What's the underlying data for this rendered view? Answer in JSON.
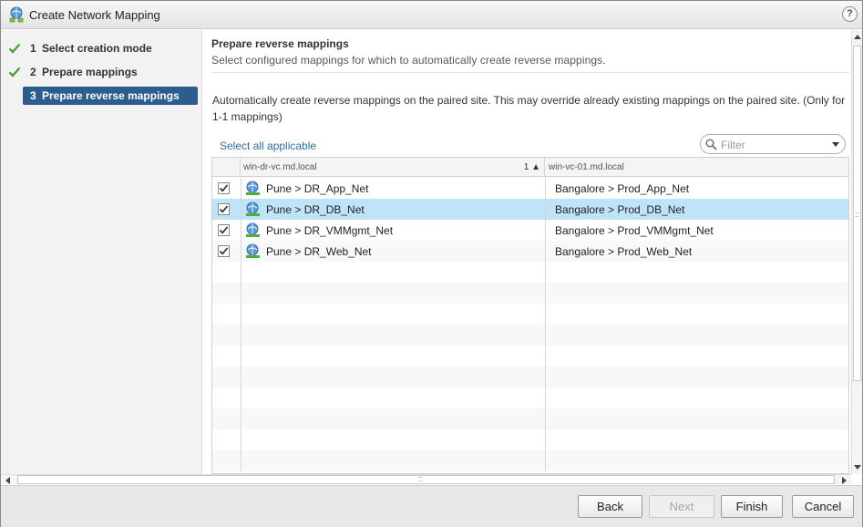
{
  "window": {
    "title": "Create Network Mapping",
    "help_label": "?"
  },
  "steps": [
    {
      "num": "1",
      "label": "Select creation mode",
      "state": "done"
    },
    {
      "num": "2",
      "label": "Prepare mappings",
      "state": "done"
    },
    {
      "num": "3",
      "label": "Prepare reverse mappings",
      "state": "active"
    }
  ],
  "section": {
    "title": "Prepare reverse mappings",
    "subtitle": "Select configured mappings for which to automatically create reverse mappings.",
    "description": "Automatically create reverse mappings on the paired site. This may override already existing mappings on the paired site. (Only for 1-1 mappings)"
  },
  "toolbar": {
    "select_all_label": "Select all applicable",
    "filter_placeholder": "Filter"
  },
  "grid": {
    "columns": [
      {
        "label": "win-dr-vc.md.local",
        "sort": "1 ▲"
      },
      {
        "label": "win-vc-01.md.local"
      }
    ],
    "rows": [
      {
        "checked": true,
        "source": "Pune > DR_App_Net",
        "target": "Bangalore > Prod_App_Net",
        "selected": false
      },
      {
        "checked": true,
        "source": "Pune > DR_DB_Net",
        "target": "Bangalore > Prod_DB_Net",
        "selected": true
      },
      {
        "checked": true,
        "source": "Pune > DR_VMMgmt_Net",
        "target": "Bangalore > Prod_VMMgmt_Net",
        "selected": false
      },
      {
        "checked": true,
        "source": "Pune > DR_Web_Net",
        "target": "Bangalore > Prod_Web_Net",
        "selected": false
      }
    ]
  },
  "buttons": {
    "back": "Back",
    "next": "Next",
    "finish": "Finish",
    "cancel": "Cancel"
  },
  "colors": {
    "active_step": "#2d5d8e",
    "selected_row": "#bfe3f7",
    "link": "#2d6da3",
    "check": "#3f9d2e"
  }
}
